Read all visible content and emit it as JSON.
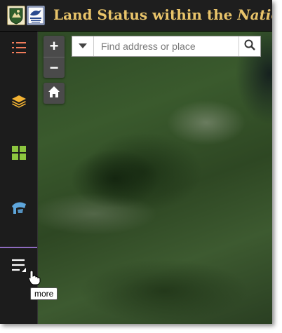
{
  "header": {
    "title_prefix": "Land Status within the ",
    "title_emphasis": "National"
  },
  "sidebar": {
    "items": [
      {
        "name": "list-icon",
        "color": "#f07b5a"
      },
      {
        "name": "layers-icon",
        "color": "#f2b233"
      },
      {
        "name": "grid-icon",
        "color": "#8dc63f"
      },
      {
        "name": "basemap-icon",
        "color": "#5ea6dc"
      },
      {
        "name": "more-icon",
        "color": "#ffffff"
      }
    ]
  },
  "map": {
    "zoom_in_label": "+",
    "zoom_out_label": "−",
    "search_placeholder": "Find address or place"
  },
  "tooltip": {
    "text": "more"
  },
  "colors": {
    "header_bg": "#1e1e1e",
    "title": "#e9c46a",
    "sidebar_bg": "#1c1c1c",
    "active_indicator": "#8e6bbf"
  }
}
